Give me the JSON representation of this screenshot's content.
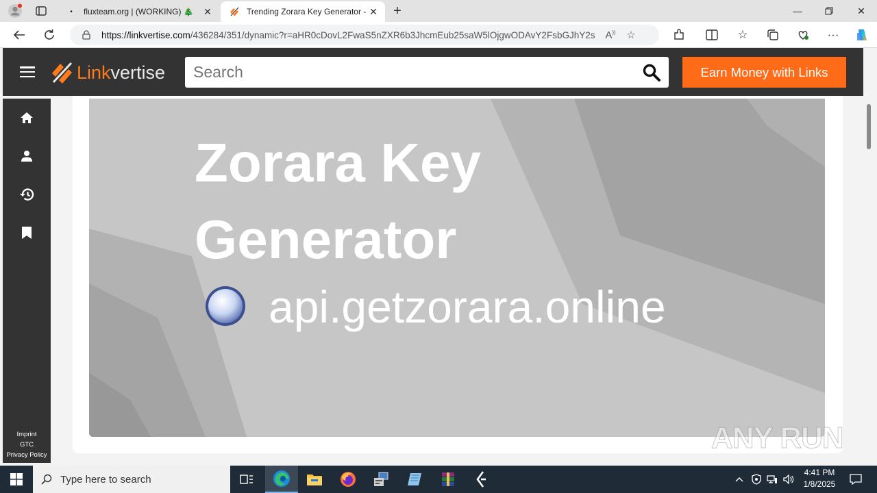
{
  "browser": {
    "tabs": [
      {
        "title": "fluxteam.org | (WORKING) 🎄",
        "active": false
      },
      {
        "title": "Trending Zorara Key Generator - L",
        "active": true
      }
    ],
    "url_host": "https://linkvertise.com",
    "url_path": "/436284/351/dynamic?r=aHR0cDovL2FwaS5nZXR6b3JhcmEub25saW5lOjgwODAvY2FsbGJhY2s"
  },
  "linkvertise": {
    "logo_part1": "Link",
    "logo_part2": "vertise",
    "search_placeholder": "Search",
    "earn_button": "Earn Money with Links",
    "footer_links": [
      "Imprint",
      "GTC",
      "Privacy Policy"
    ],
    "brand_color": "#ff6b16"
  },
  "banner": {
    "title": "Zorara Key Generator",
    "domain": "api.getzorara.online"
  },
  "watermark": "ANY RUN",
  "taskbar": {
    "search_placeholder": "Type here to search",
    "time": "4:41 PM",
    "date": "1/8/2025"
  }
}
